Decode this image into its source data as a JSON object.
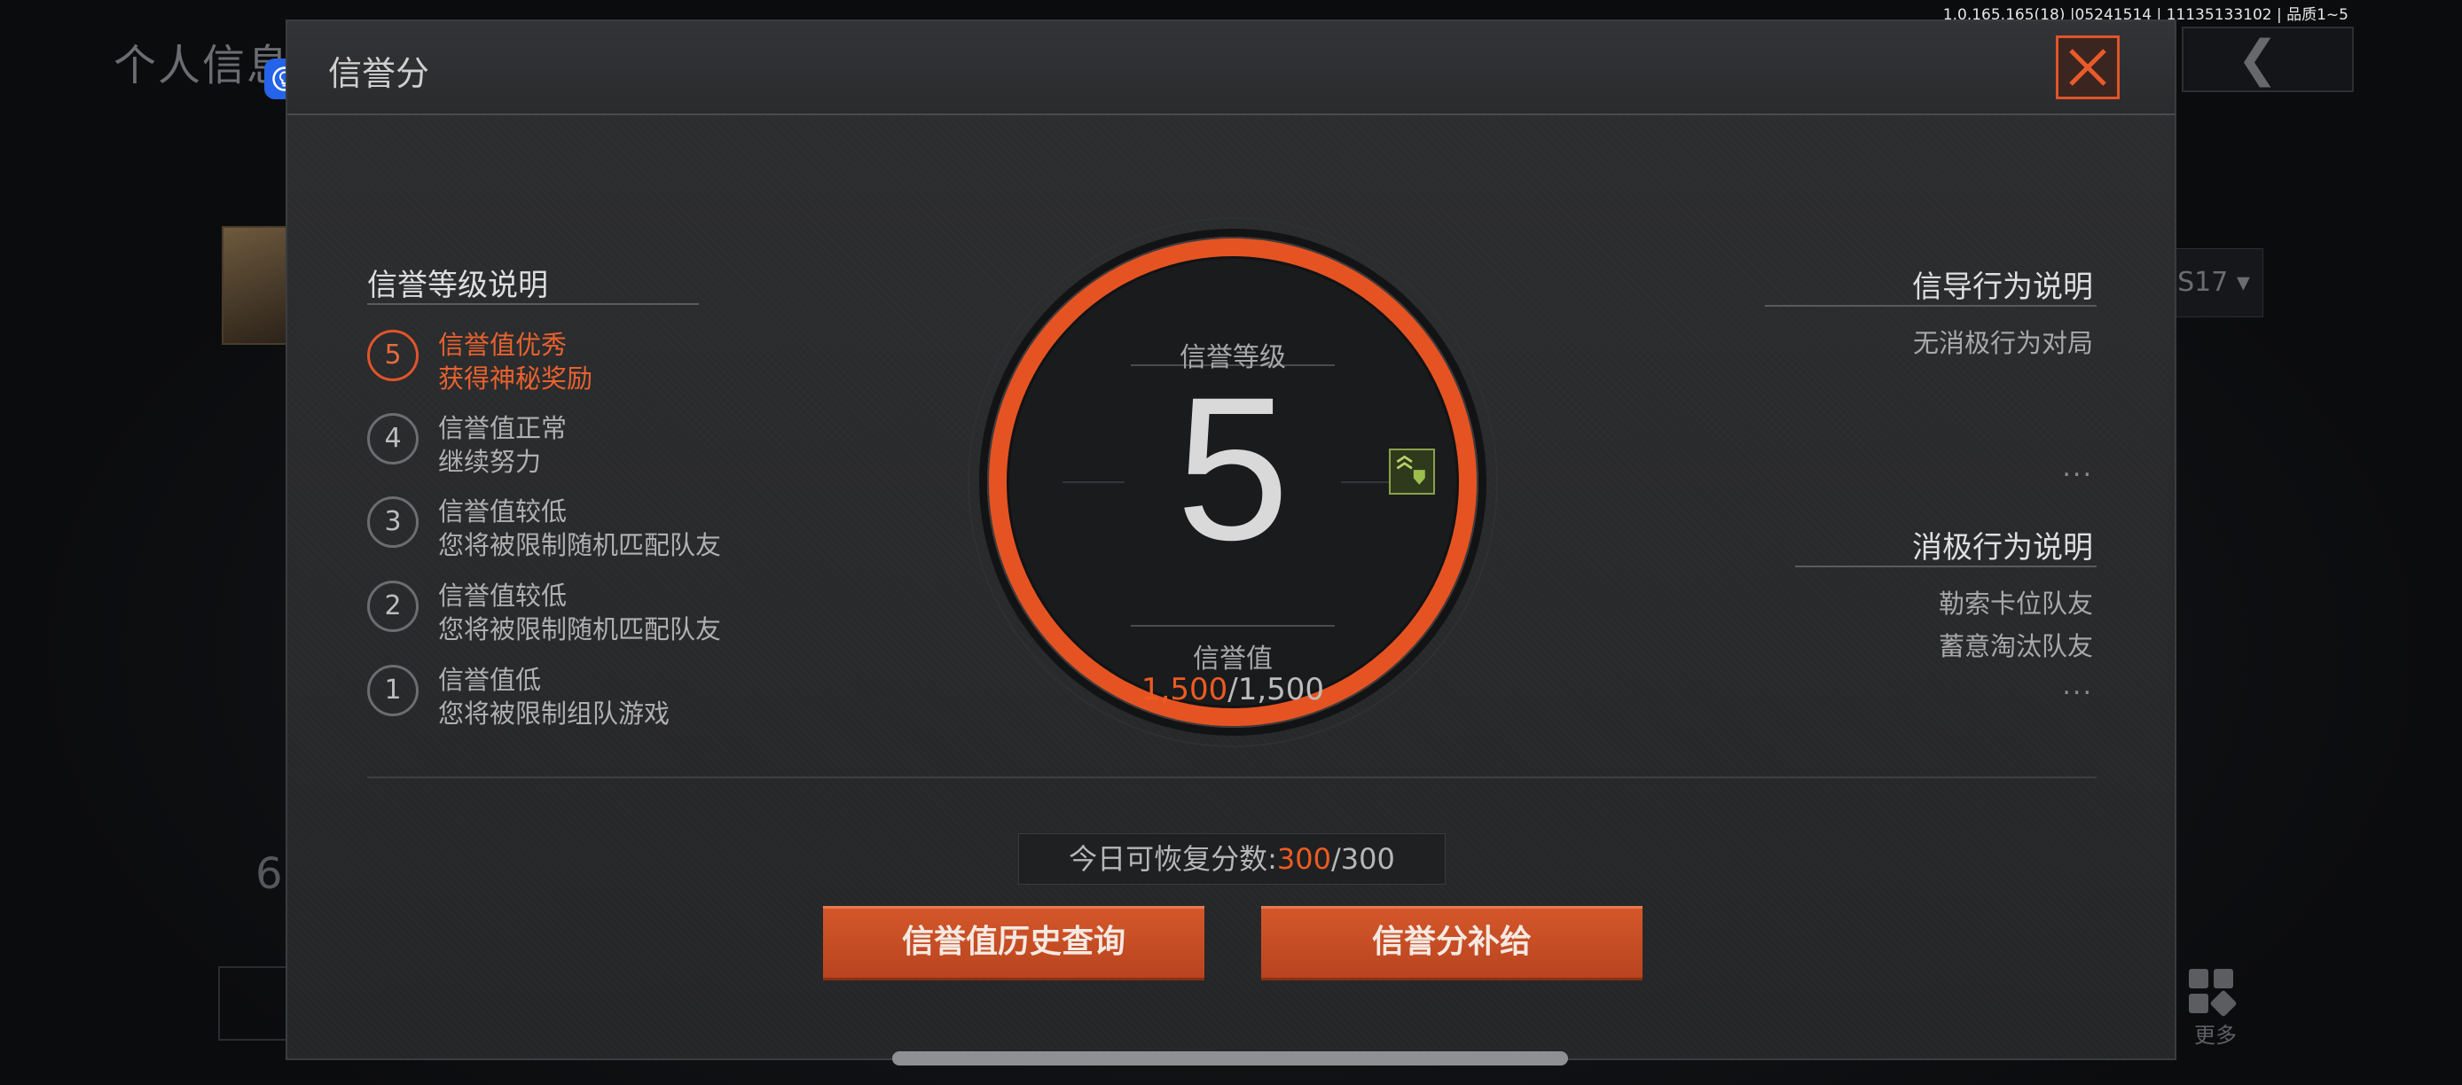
{
  "background": {
    "page_title": "个人信息",
    "version_text": "1.0.165.165(18) |05241514 | 11135133102 | 品质1~5",
    "season_tag": "S17",
    "score_partial": "6",
    "more_label": "更多",
    "icons": {
      "back": "chevron-left-icon",
      "more": "grid-icon"
    }
  },
  "overlay_icons": [
    "lightbulb-icon",
    "chat-bubble-icon"
  ],
  "modal": {
    "title": "信誉分",
    "close_icon": "close-icon",
    "accent_color": "#e0552a",
    "levels_section": {
      "title": "信誉等级说明",
      "levels": [
        {
          "num": "5",
          "line1": "信誉值优秀",
          "line2": "获得神秘奖励",
          "active": true
        },
        {
          "num": "4",
          "line1": "信誉值正常",
          "line2": "继续努力",
          "active": false
        },
        {
          "num": "3",
          "line1": "信誉值较低",
          "line2": "您将被限制随机匹配队友",
          "active": false
        },
        {
          "num": "2",
          "line1": "信誉值较低",
          "line2": "您将被限制随机匹配队友",
          "active": false
        },
        {
          "num": "1",
          "line1": "信誉值低",
          "line2": "您将被限制组队游戏",
          "active": false
        }
      ]
    },
    "dial": {
      "level_label": "信誉等级",
      "level": "5",
      "value_label": "信誉值",
      "value_current": "1,500",
      "value_max": "/1,500",
      "badge_icon": "rank-chevron-shield-icon"
    },
    "positive_section": {
      "title": "信导行为说明",
      "items": [
        "无消极行为对局"
      ],
      "more": "..."
    },
    "negative_section": {
      "title": "消极行为说明",
      "items": [
        "勒索卡位队友",
        "蓄意淘汰队友"
      ],
      "more": "..."
    },
    "restore": {
      "label": "今日可恢复分数:",
      "current": "300",
      "max": "/300"
    },
    "buttons": {
      "history": "信誉值历史查询",
      "supply": "信誉分补给"
    }
  }
}
